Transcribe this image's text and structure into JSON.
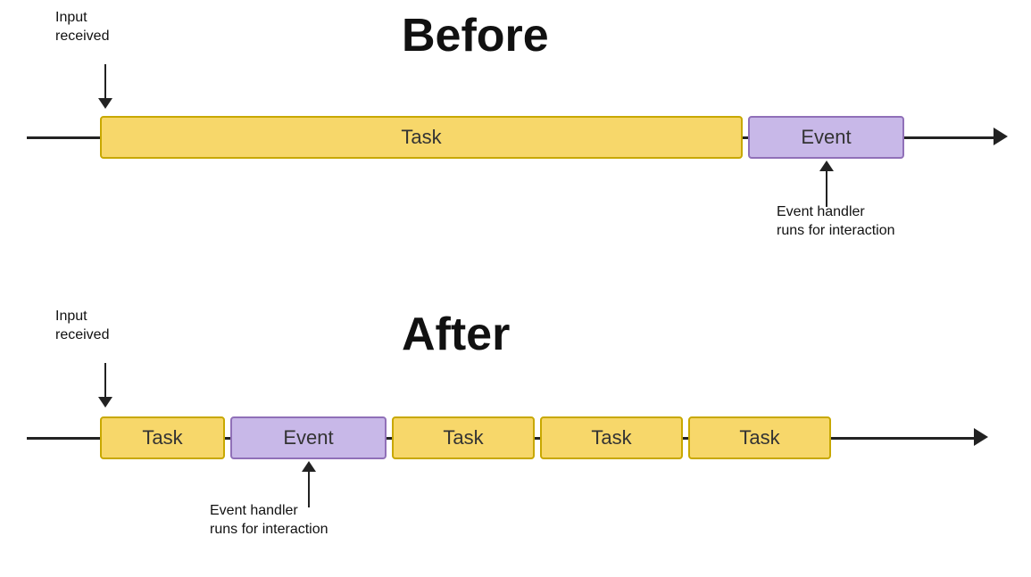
{
  "before": {
    "title": "Before",
    "input_label": "Input\nreceived",
    "event_handler_label": "Event handler\nruns for interaction",
    "task_label": "Task",
    "event_label": "Event"
  },
  "after": {
    "title": "After",
    "input_label": "Input\nreceived",
    "event_handler_label": "Event handler\nruns for interaction",
    "task_label": "Task",
    "event_label": "Event",
    "task2_label": "Task",
    "task3_label": "Task",
    "task4_label": "Task"
  }
}
